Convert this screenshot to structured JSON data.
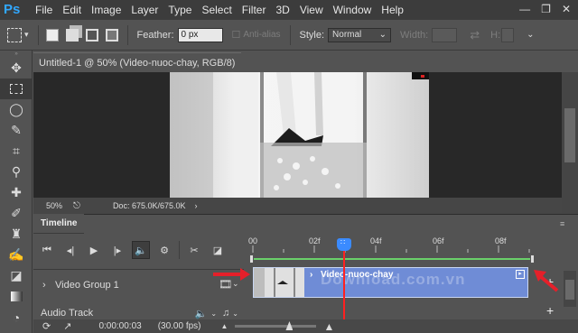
{
  "menubar": {
    "logo": "Ps",
    "items": [
      "File",
      "Edit",
      "Image",
      "Layer",
      "Type",
      "Select",
      "Filter",
      "3D",
      "View",
      "Window",
      "Help"
    ],
    "controls": [
      "—",
      "❐",
      "✕"
    ]
  },
  "options": {
    "feather_label": "Feather:",
    "feather_value": "0 px",
    "antialias_label": "Anti-alias",
    "style_label": "Style:",
    "style_value": "Normal",
    "width_label": "Width:",
    "height_label": "H:"
  },
  "document": {
    "tab_title": "Untitled-1 @ 50% (Video-nuoc-chay, RGB/8) *",
    "tab_close": "×",
    "zoom": "50%",
    "doc_info": "Doc: 675.0K/675.0K"
  },
  "timeline": {
    "tab_label": "Timeline",
    "ruler_labels": [
      "00",
      "02f",
      "04f",
      "06f",
      "08f"
    ],
    "group_label": "Video Group 1",
    "clip_name": "Video-nuoc-chay",
    "audio_label": "Audio Track",
    "timecode": "0:00:00:03",
    "fps": "(30.00 fps)",
    "playhead_frame": 3,
    "total_frames": 9
  },
  "watermark": "Download.com.vn",
  "colors": {
    "accent": "#31a8ff",
    "clip": "#6f8cd6",
    "playhead": "#ff2020",
    "arrow": "#e5202a"
  }
}
